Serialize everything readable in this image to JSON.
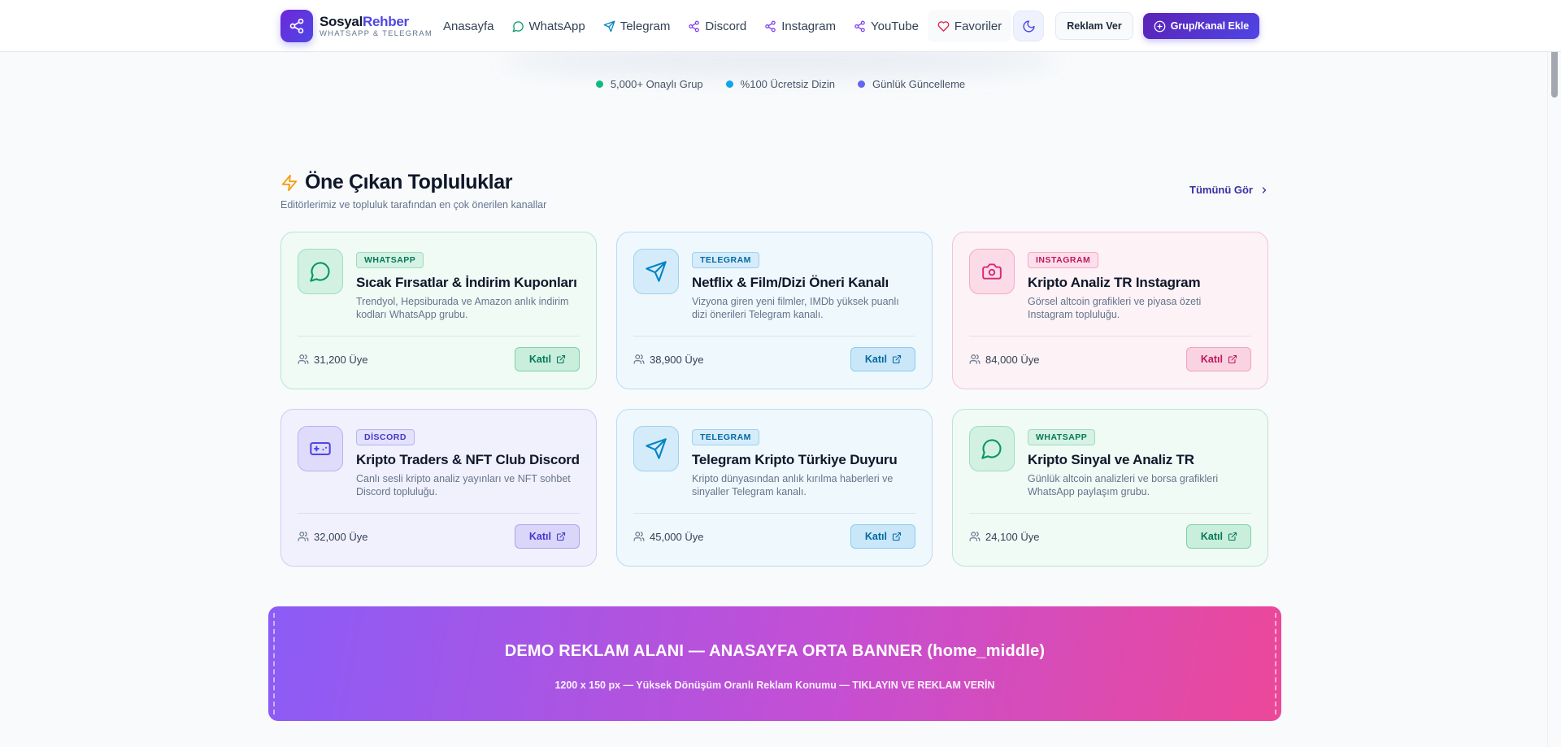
{
  "header": {
    "brand_main": "Sosyal",
    "brand_accent": "Rehber",
    "brand_sub": "WHATSAPP & TELEGRAM",
    "nav": {
      "home": "Anasayfa",
      "whatsapp": "WhatsApp",
      "telegram": "Telegram",
      "discord": "Discord",
      "instagram": "Instagram",
      "youtube": "YouTube",
      "favorites": "Favoriler"
    },
    "advertise_label": "Reklam Ver",
    "add_label": "Grup/Kanal Ekle"
  },
  "stats": [
    {
      "label": "5,000+ Onaylı Grup",
      "color": "#10b981"
    },
    {
      "label": "%100 Ücretsiz Dizin",
      "color": "#0ea5e9"
    },
    {
      "label": "Günlük Güncelleme",
      "color": "#6366f1"
    }
  ],
  "featured": {
    "title": "Öne Çıkan Topluluklar",
    "subtitle": "Editörlerimiz ve topluluk tarafından en çok önerilen kanallar",
    "see_all": "Tümünü Gör",
    "join_label": "Katıl",
    "cards": [
      {
        "platform": "WHATSAPP",
        "icon": "whatsapp-chat-icon",
        "title": "Sıcak Fırsatlar & İndirim Kuponları",
        "description": "Trendyol, Hepsiburada ve Amazon anlık indirim kodları WhatsApp grubu.",
        "members": "31,200 Üye"
      },
      {
        "platform": "TELEGRAM",
        "icon": "telegram-send-icon",
        "title": "Netflix & Film/Dizi Öneri Kanalı",
        "description": "Vizyona giren yeni filmler, IMDb yüksek puanlı dizi önerileri Telegram kanalı.",
        "members": "38,900 Üye"
      },
      {
        "platform": "INSTAGRAM",
        "icon": "camera-icon",
        "title": "Kripto Analiz TR Instagram",
        "description": "Görsel altcoin grafikleri ve piyasa özeti Instagram topluluğu.",
        "members": "84,000 Üye"
      },
      {
        "platform": "DİSCORD",
        "icon": "gamepad-icon",
        "title": "Kripto Traders & NFT Club Discord",
        "description": "Canlı sesli kripto analiz yayınları ve NFT sohbet Discord topluluğu.",
        "members": "32,000 Üye"
      },
      {
        "platform": "TELEGRAM",
        "icon": "telegram-send-icon",
        "title": "Telegram Kripto Türkiye Duyuru",
        "description": "Kripto dünyasından anlık kırılma haberleri ve sinyaller Telegram kanalı.",
        "members": "45,000 Üye"
      },
      {
        "platform": "WHATSAPP",
        "icon": "whatsapp-chat-icon",
        "title": "Kripto Sinyal ve Analiz TR",
        "description": "Günlük altcoin analizleri ve borsa grafikleri WhatsApp paylaşım grubu.",
        "members": "24,100 Üye"
      }
    ]
  },
  "banner": {
    "title": "DEMO REKLAM ALANI — ANASAYFA ORTA BANNER (home_middle)",
    "subtitle": "1200 x 150 px — Yüksek Dönüşüm Oranlı Reklam Konumu — TIKLAYIN VE REKLAM VERİN"
  },
  "colors": {
    "accent": "#4f46e5",
    "whatsapp": "#059669",
    "telegram": "#0284c7",
    "instagram": "#db2777",
    "discord": "#4f46e5",
    "favorite": "#e11d48"
  }
}
